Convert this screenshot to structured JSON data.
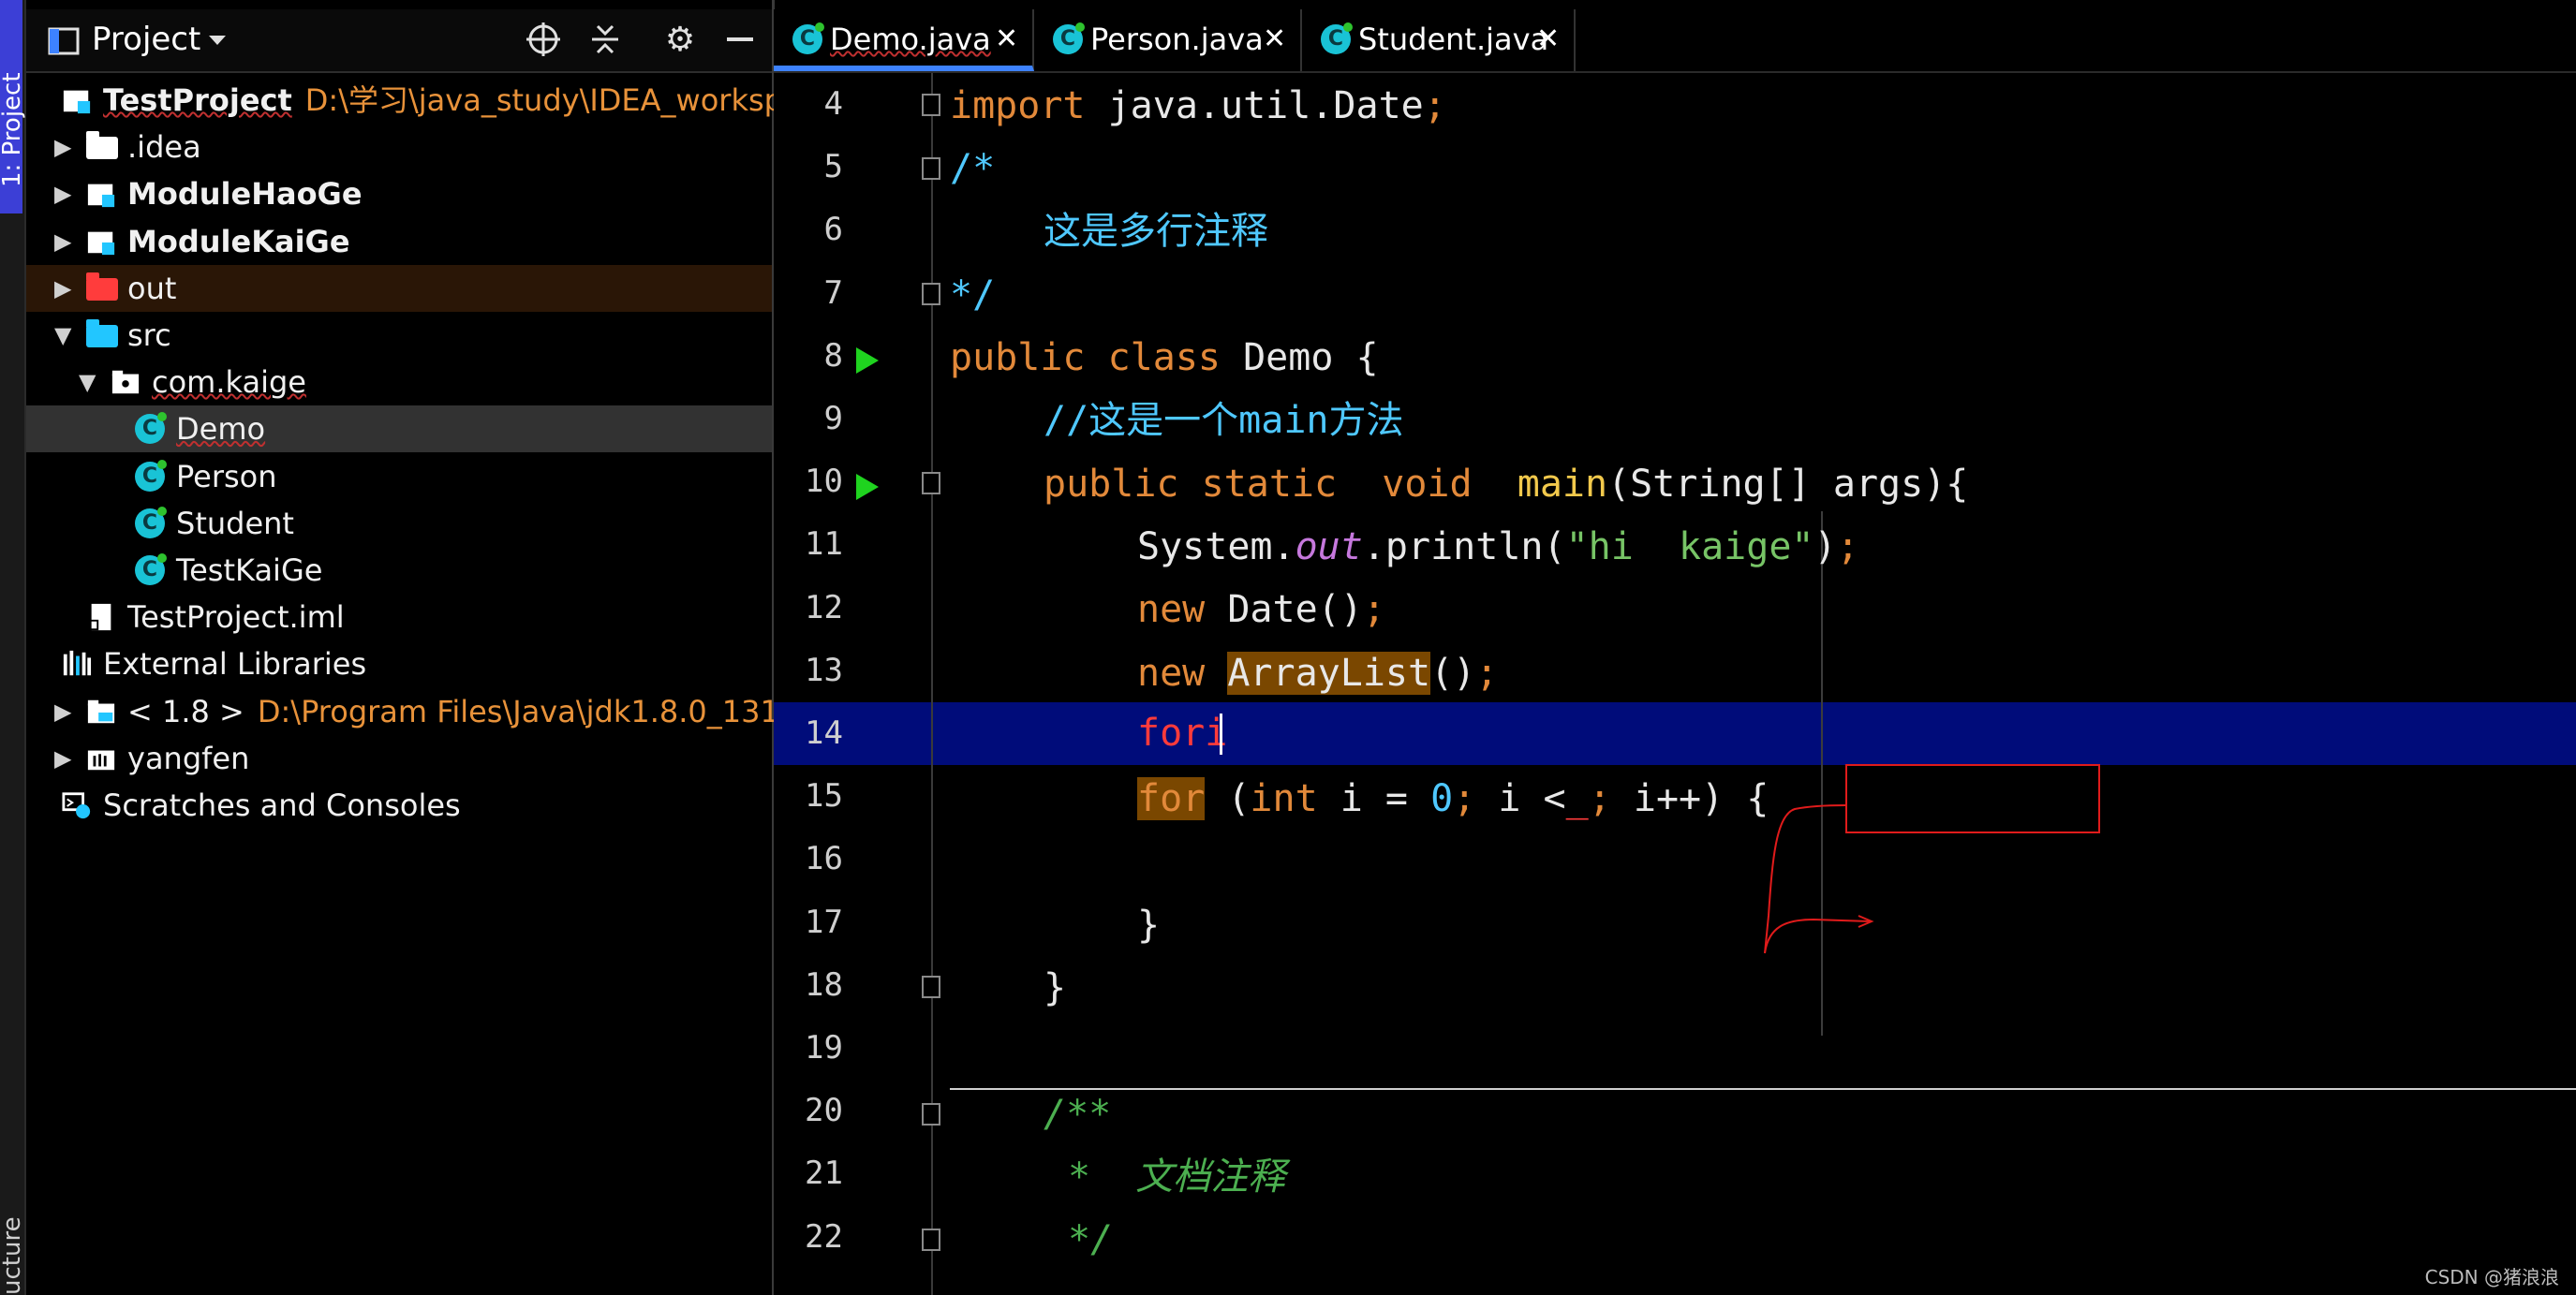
{
  "toolwindow": {
    "project_tab": "1: Project",
    "structure_tab": "ucture"
  },
  "project_panel": {
    "title": "Project",
    "icons": [
      "view-mode-icon",
      "chevron-down-icon",
      "locate-icon",
      "collapse-all-icon",
      "gear-icon",
      "minimize-icon"
    ],
    "tree": [
      {
        "label": "TestProject",
        "path": "D:\\学习\\java_study\\IDEA_workspace\\Te",
        "icon": "module-icon",
        "bold": true,
        "indent": 0,
        "arrow": ""
      },
      {
        "label": ".idea",
        "icon": "folder-white",
        "indent": 1,
        "arrow": "right"
      },
      {
        "label": "ModuleHaoGe",
        "icon": "module-icon",
        "bold": true,
        "indent": 1,
        "arrow": "right"
      },
      {
        "label": "ModuleKaiGe",
        "icon": "module-icon",
        "bold": true,
        "indent": 1,
        "arrow": "right"
      },
      {
        "label": "out",
        "icon": "folder-red",
        "indent": 1,
        "arrow": "right"
      },
      {
        "label": "src",
        "icon": "folder-blue",
        "indent": 1,
        "arrow": "down"
      },
      {
        "label": "com.kaige",
        "icon": "package-icon",
        "indent": 2,
        "arrow": "down"
      },
      {
        "label": "Demo",
        "icon": "class-icon",
        "indent": 3,
        "arrow": ""
      },
      {
        "label": "Person",
        "icon": "class-icon",
        "indent": 3,
        "arrow": ""
      },
      {
        "label": "Student",
        "icon": "class-icon",
        "indent": 3,
        "arrow": ""
      },
      {
        "label": "TestKaiGe",
        "icon": "class-icon",
        "indent": 3,
        "arrow": ""
      },
      {
        "label": "TestProject.iml",
        "icon": "iml-file-icon",
        "indent": 1,
        "arrow": ""
      },
      {
        "label": "External Libraries",
        "icon": "libraries-icon",
        "indent": 0,
        "arrow": ""
      },
      {
        "label": "< 1.8 >",
        "path": "D:\\Program Files\\Java\\jdk1.8.0_131",
        "icon": "jdk-icon",
        "indent": 1,
        "arrow": "right"
      },
      {
        "label": "yangfen",
        "icon": "library-icon",
        "indent": 1,
        "arrow": "right"
      },
      {
        "label": "Scratches and Consoles",
        "icon": "scratches-icon",
        "indent": 0,
        "arrow": ""
      }
    ]
  },
  "tabs": [
    {
      "label": "Demo.java",
      "active": true
    },
    {
      "label": "Person.java",
      "active": false
    },
    {
      "label": "Student.java",
      "active": false
    }
  ],
  "editor": {
    "line_numbers": [
      "4",
      "5",
      "6",
      "7",
      "8",
      "9",
      "10",
      "11",
      "12",
      "13",
      "14",
      "15",
      "16",
      "17",
      "18",
      "19",
      "20",
      "21",
      "22"
    ],
    "lines": {
      "l4": {
        "kw": "import",
        "rest": " java.util.Date",
        "semi": ";"
      },
      "l5": "/*",
      "l6": "这是多行注释",
      "l7": "*/",
      "l8": {
        "kw": "public class",
        "rest": " Demo {"
      },
      "l9": "//这是一个main方法",
      "l10": {
        "kw": "public static  void",
        "fn": "main",
        "rest": "(String[] args){"
      },
      "l11": {
        "a": "System.",
        "field": "out",
        "b": ".println(",
        "str": "\"hi  kaige\"",
        "c": ")",
        "semi": ";"
      },
      "l12": {
        "kw": "new",
        "rest": " Date()",
        "semi": ";"
      },
      "l13": {
        "kw": "new",
        "hl": "ArrayList",
        "rest": "()",
        "semi": ";"
      },
      "l14": "fori",
      "l15": {
        "kw": "for",
        "a": " (",
        "kw2": "int",
        "b": " i = ",
        "num": "0",
        "semi1": ";",
        "c": " i <",
        "cursor": "_",
        "semi2": ";",
        "d": " i++) {"
      },
      "l17": "}",
      "l18": "}",
      "l20": "/**",
      "l21": "*  文档注释",
      "l22": "*/"
    }
  },
  "watermark": "CSDN @猪浪浪"
}
